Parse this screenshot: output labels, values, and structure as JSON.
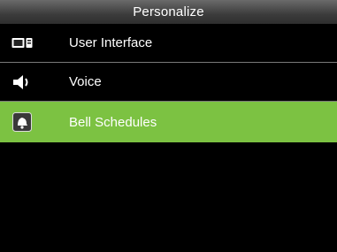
{
  "header": {
    "title": "Personalize"
  },
  "menu": {
    "items": [
      {
        "label": "User Interface",
        "icon": "monitor-icon",
        "selected": false
      },
      {
        "label": "Voice",
        "icon": "speaker-icon",
        "selected": false
      },
      {
        "label": "Bell Schedules",
        "icon": "bell-icon",
        "selected": true
      }
    ]
  },
  "colors": {
    "selection": "#7cc242",
    "background": "#000000",
    "text": "#ffffff"
  }
}
